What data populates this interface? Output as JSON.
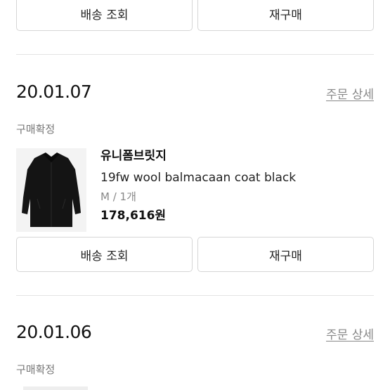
{
  "top_buttons": {
    "track": "배송 조회",
    "reorder": "재구매"
  },
  "orders": [
    {
      "date": "20.01.07",
      "detail_link": "주문 상세",
      "status": "구매확정",
      "item": {
        "brand": "유니폼브릿지",
        "name": "19fw wool balmacaan coat black",
        "option": "M / 1개",
        "price": "178,616원",
        "image": "black-balmacaan-coat"
      },
      "buttons": {
        "track": "배송 조회",
        "reorder": "재구매"
      }
    },
    {
      "date": "20.01.06",
      "detail_link": "주문 상세",
      "status": "구매확정"
    }
  ]
}
